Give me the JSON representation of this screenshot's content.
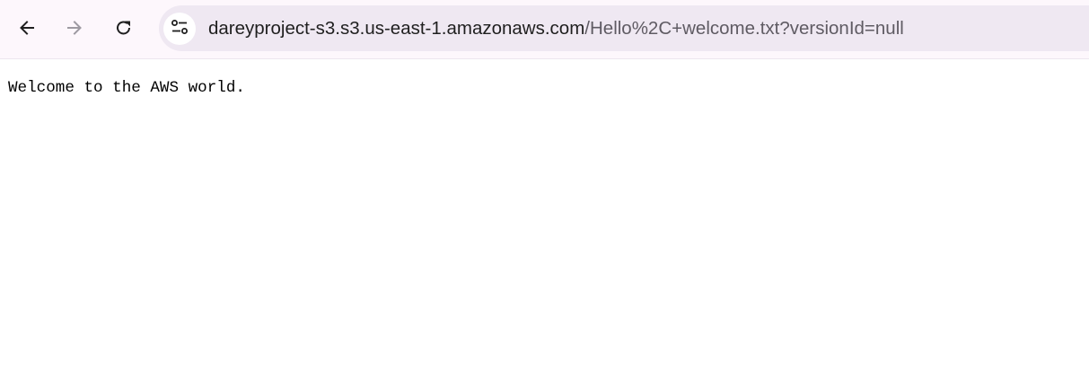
{
  "browser": {
    "nav": {
      "back_icon": "arrow-left-icon",
      "forward_icon": "arrow-right-icon",
      "reload_icon": "reload-icon"
    },
    "address_bar": {
      "site_info_icon": "tune-icon",
      "host": "dareyproject-s3.s3.us-east-1.amazonaws.com",
      "path": "/Hello%2C+welcome.txt?versionId=null"
    },
    "colors": {
      "toolbar_bg": "#fdf7fc",
      "omnibox_bg": "#efe8f2",
      "host_text": "#1f1f1f",
      "path_text": "#5f5b63",
      "disabled_icon": "#9e9aa2"
    }
  },
  "page": {
    "text": "Welcome to the AWS world."
  }
}
